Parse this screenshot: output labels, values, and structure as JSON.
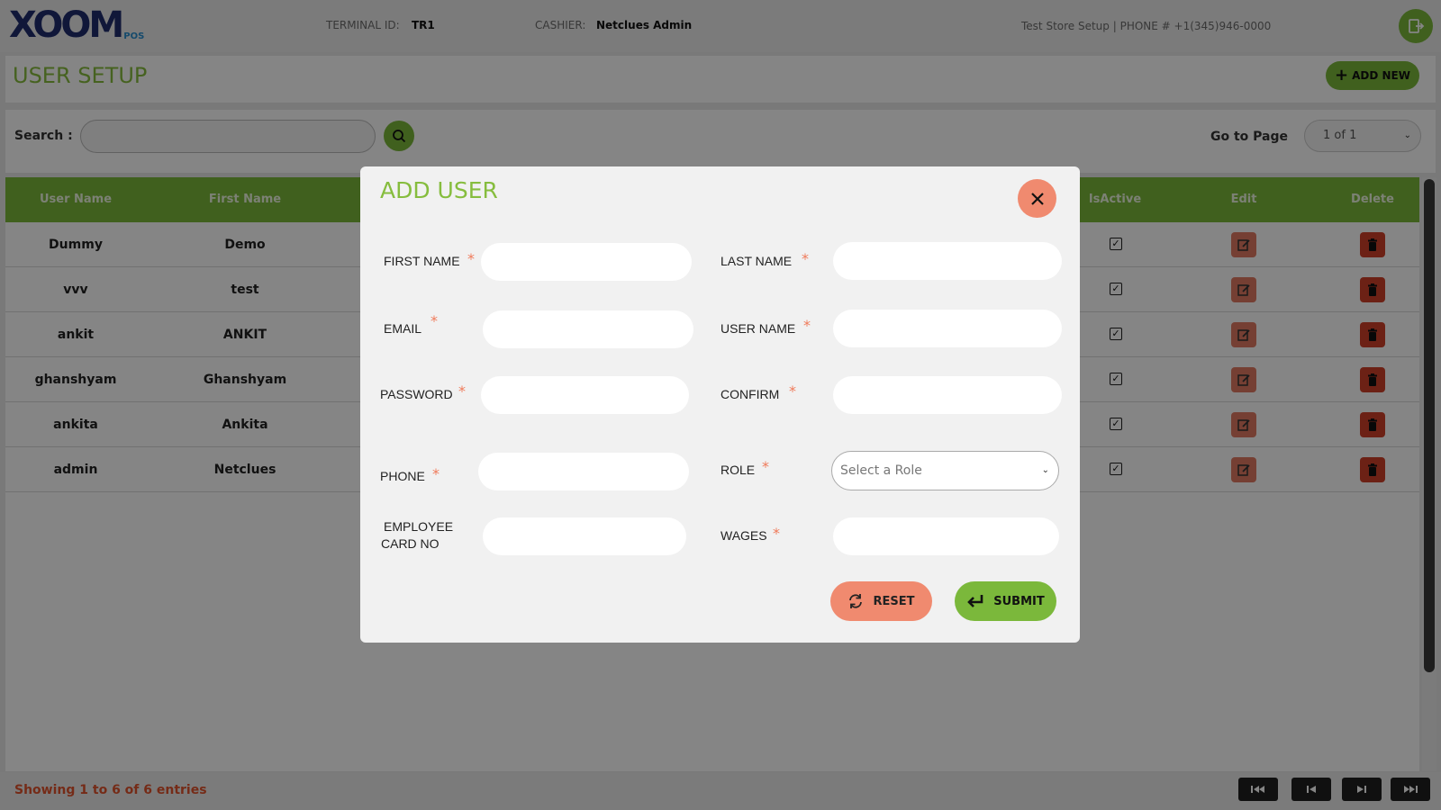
{
  "header": {
    "logo_text": "XOOM",
    "logo_sub": "POS",
    "terminal_label": "TERMINAL ID:",
    "terminal_value": "TR1",
    "cashier_label": "CASHIER:",
    "cashier_value": "Netclues Admin",
    "store_info": "Test Store Setup | PHONE # +1(345)946-0000",
    "logout_icon": "logout-icon"
  },
  "page": {
    "title": "USER SETUP",
    "add_new_label": "ADD NEW"
  },
  "search": {
    "label": "Search :",
    "value": "",
    "go_to_page_label": "Go to Page",
    "page_select_value": "1 of 1"
  },
  "table": {
    "columns": {
      "user_name": "User Name",
      "first_name": "First Name",
      "is_active": "IsActive",
      "edit": "Edit",
      "delete": "Delete"
    },
    "rows": [
      {
        "user_name": "Dummy",
        "first_name": "Demo",
        "is_active": true
      },
      {
        "user_name": "vvv",
        "first_name": "test",
        "is_active": true
      },
      {
        "user_name": "ankit",
        "first_name": "ANKIT",
        "is_active": true
      },
      {
        "user_name": "ghanshyam",
        "first_name": "Ghanshyam",
        "is_active": true
      },
      {
        "user_name": "ankita",
        "first_name": "Ankita",
        "is_active": true
      },
      {
        "user_name": "admin",
        "first_name": "Netclues",
        "is_active": true
      }
    ]
  },
  "footer": {
    "showing_text": "Showing 1 to 6 of 6 entries"
  },
  "modal": {
    "title": "ADD USER",
    "required_mark": "*",
    "fields": {
      "first_name": {
        "label": "FIRST NAME",
        "value": ""
      },
      "last_name": {
        "label": "LAST NAME",
        "value": ""
      },
      "email": {
        "label": "EMAIL",
        "value": ""
      },
      "user_name": {
        "label": "USER NAME",
        "value": ""
      },
      "password": {
        "label": "PASSWORD",
        "value": ""
      },
      "confirm": {
        "label": "CONFIRM",
        "value": ""
      },
      "phone": {
        "label": "PHONE",
        "value": ""
      },
      "role": {
        "label": "ROLE",
        "placeholder": "Select a Role"
      },
      "employee_card_line1": {
        "label": "EMPLOYEE"
      },
      "employee_card_line2": {
        "label": "CARD NO"
      },
      "employee_card": {
        "value": ""
      },
      "wages": {
        "label": "WAGES",
        "value": ""
      }
    },
    "reset_label": "RESET",
    "submit_label": "SUBMIT"
  },
  "colors": {
    "brand_green": "#7bb83b",
    "title_green": "#86bd3e",
    "accent_orange": "#f08a6f",
    "delete_red": "#d0402a",
    "logo_navy": "#1f2d6e"
  }
}
